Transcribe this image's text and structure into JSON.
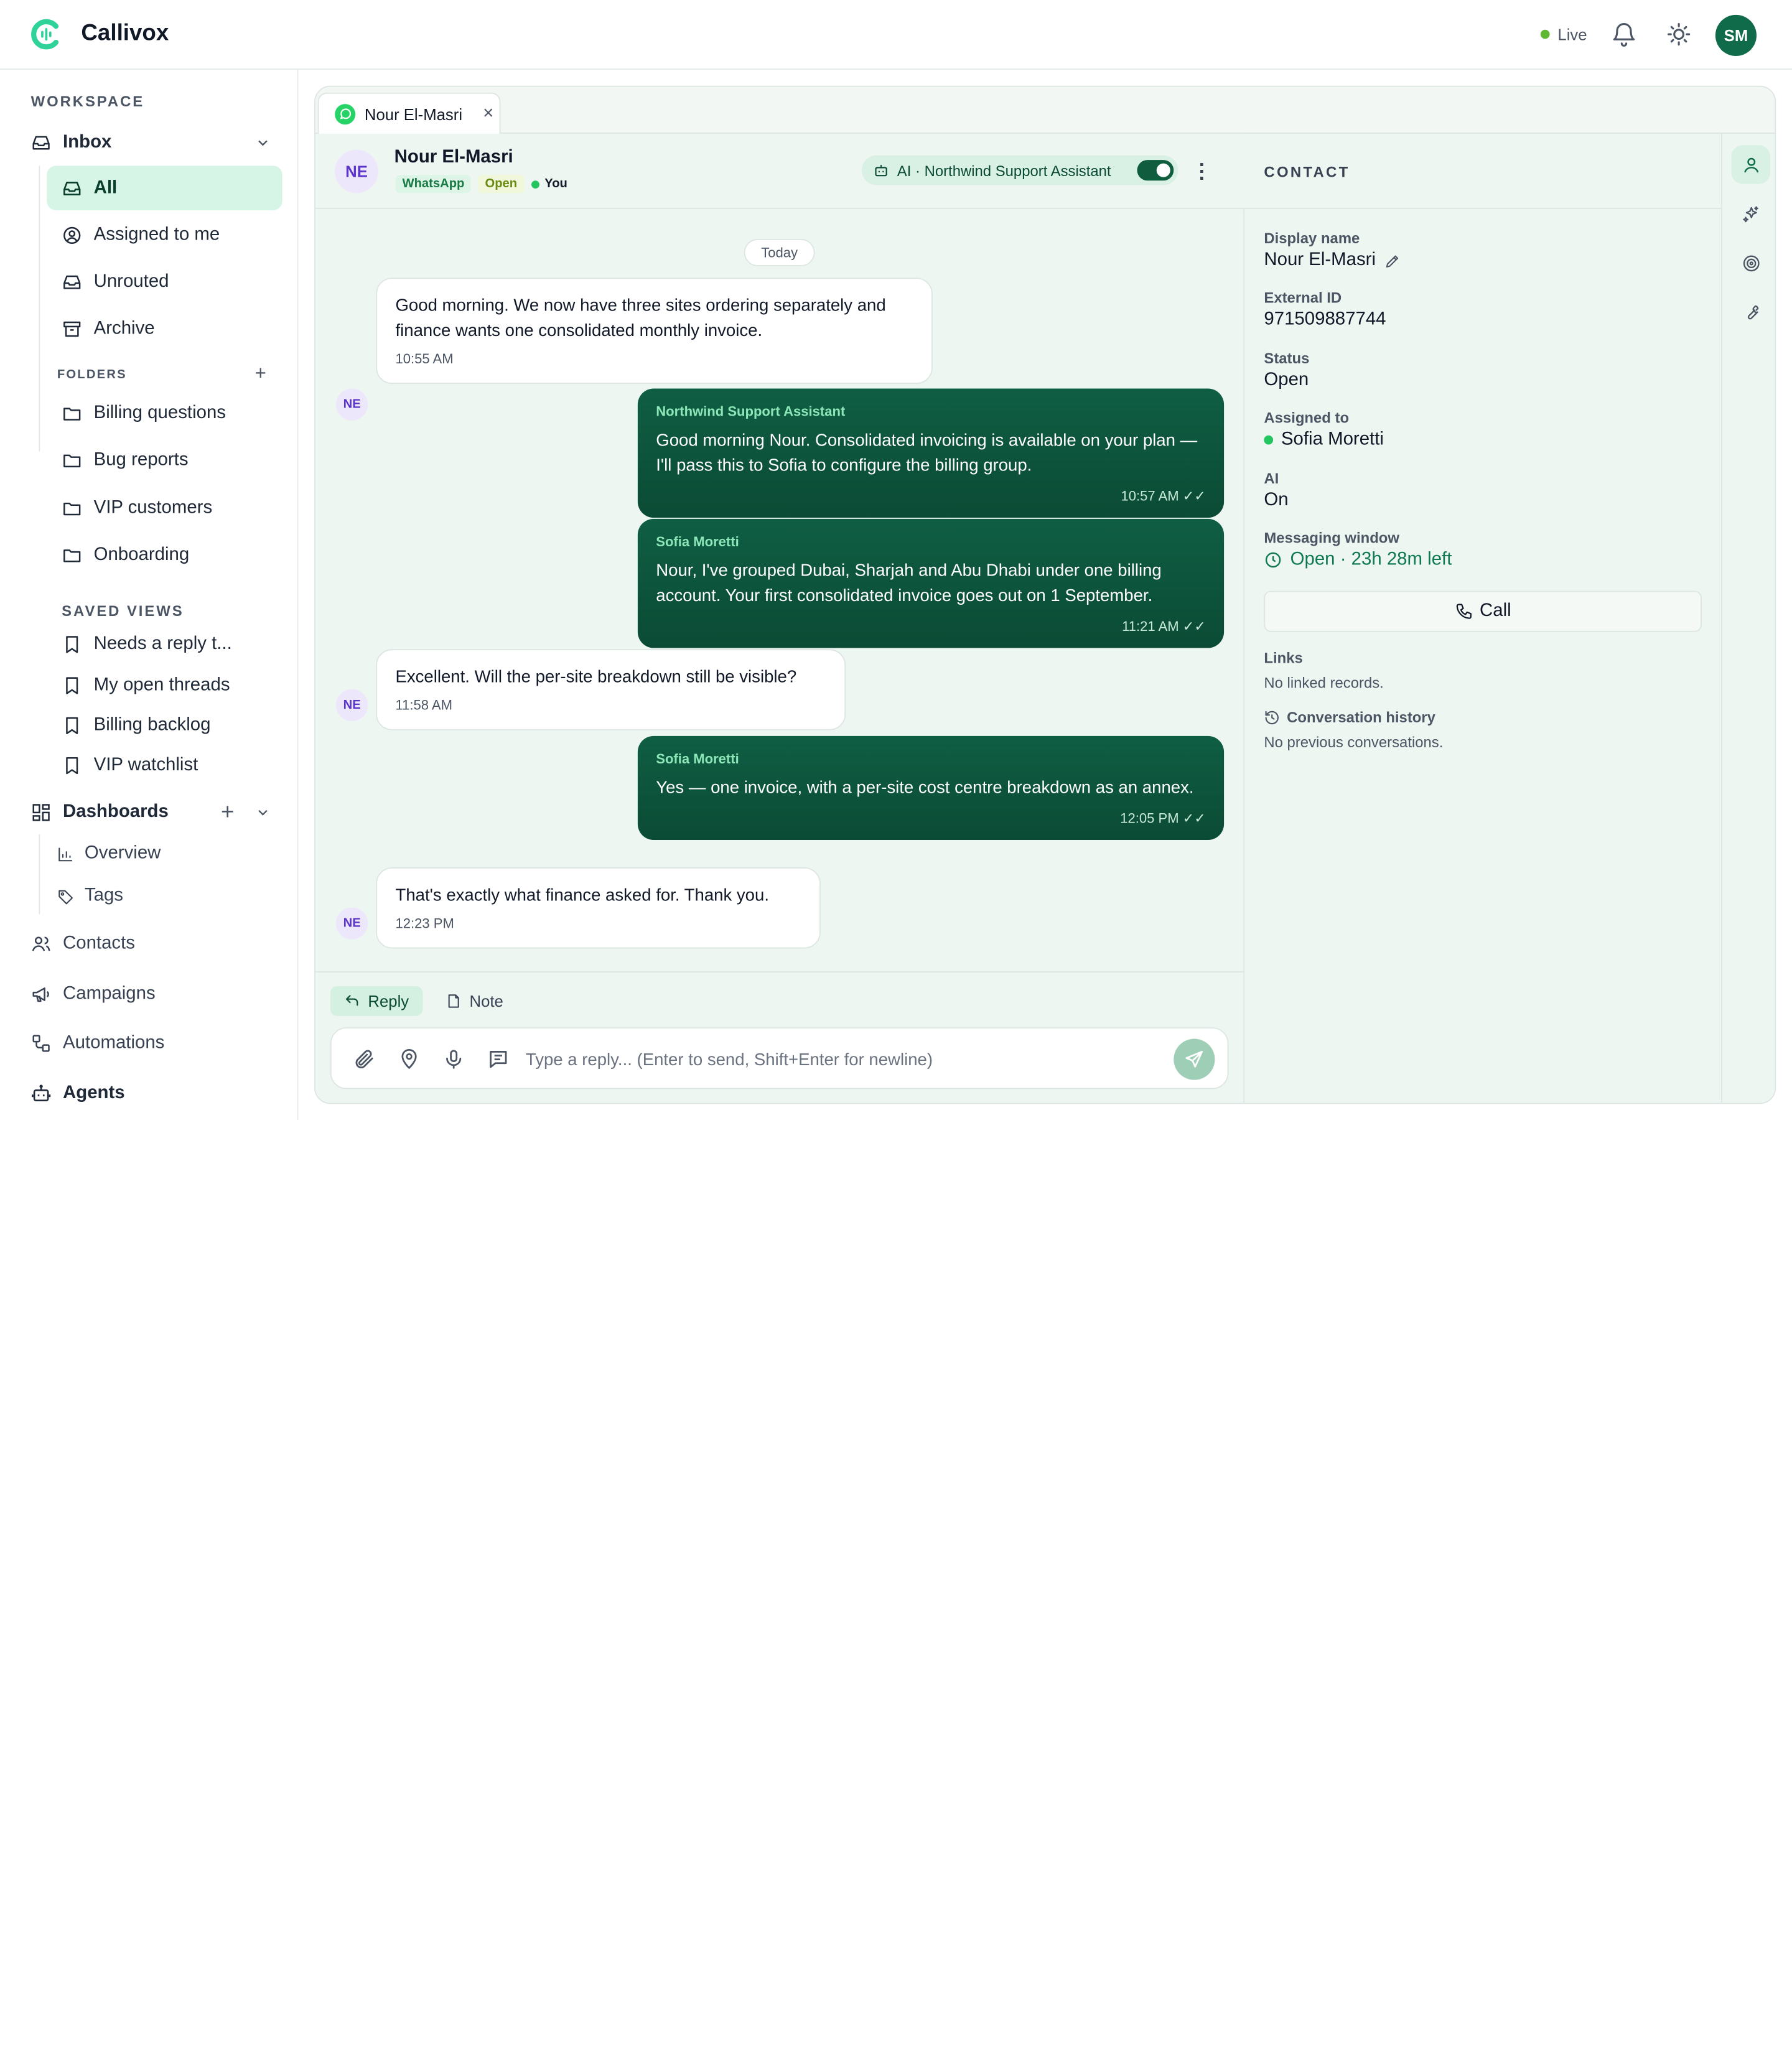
{
  "app": {
    "brand": "Callivox",
    "live_label": "Live",
    "user_initials": "SM"
  },
  "sidebar": {
    "workspace_label": "WORKSPACE",
    "inbox_label": "Inbox",
    "inbox_items": [
      {
        "label": "All",
        "icon": "inbox-icon",
        "active": true
      },
      {
        "label": "Assigned to me",
        "icon": "user-circle-icon"
      },
      {
        "label": "Unrouted",
        "icon": "inbox-icon"
      },
      {
        "label": "Archive",
        "icon": "archive-icon"
      }
    ],
    "folders_label": "FOLDERS",
    "folders": [
      "Billing questions",
      "Bug reports",
      "VIP customers",
      "Onboarding"
    ],
    "saved_views_label": "SAVED VIEWS",
    "saved_views": [
      "Needs a reply t...",
      "My open threads",
      "Billing backlog",
      "VIP watchlist"
    ],
    "dashboards_label": "Dashboards",
    "dashboard_items": [
      "Overview",
      "Tags"
    ],
    "bottom_items": [
      "Contacts",
      "Campaigns",
      "Automations",
      "Agents"
    ]
  },
  "tab": {
    "label": "Nour El-Masri",
    "close": "×"
  },
  "chat": {
    "contact_initials": "NE",
    "contact_name": "Nour El-Masri",
    "badge_channel": "WhatsApp",
    "badge_status": "Open",
    "badge_assignee": "You",
    "ai_label": "AI · Northwind Support Assistant",
    "ai_enabled": true,
    "day_label": "Today",
    "messages": [
      {
        "dir": "in",
        "text": "Good morning. We now have three sites ordering separately and finance wants one consolidated monthly invoice.",
        "time": "10:55 AM"
      },
      {
        "dir": "out",
        "sender": "Northwind Support Assistant",
        "text": "Good morning Nour. Consolidated invoicing is available on your plan — I'll pass this to Sofia to configure the billing group.",
        "time": "10:57 AM"
      },
      {
        "dir": "out",
        "sender": "Sofia Moretti",
        "text": "Nour, I've grouped Dubai, Sharjah and Abu Dhabi under one billing account. Your first consolidated invoice goes out on 1 September.",
        "time": "11:21 AM"
      },
      {
        "dir": "in",
        "text": "Excellent. Will the per-site breakdown still be visible?",
        "time": "11:58 AM"
      },
      {
        "dir": "out",
        "sender": "Sofia Moretti",
        "text": "Yes — one invoice, with a per-site cost centre breakdown as an annex.",
        "time": "12:05 PM"
      },
      {
        "dir": "in",
        "text": "That's exactly what finance asked for. Thank you.",
        "time": "12:23 PM"
      }
    ],
    "reply_tab": "Reply",
    "note_tab": "Note",
    "composer_placeholder": "Type a reply... (Enter to send, Shift+Enter for newline)"
  },
  "contact": {
    "title": "CONTACT",
    "display_name_label": "Display name",
    "display_name": "Nour El-Masri",
    "external_id_label": "External ID",
    "external_id": "971509887744",
    "status_label": "Status",
    "status": "Open",
    "assigned_label": "Assigned to",
    "assigned": "Sofia Moretti",
    "ai_label": "AI",
    "ai_value": "On",
    "window_label": "Messaging window",
    "window_value": "Open · 23h 28m left",
    "call_label": "Call",
    "links_label": "Links",
    "links_value": "No linked records.",
    "history_label": "Conversation history",
    "history_value": "No previous conversations."
  },
  "colors": {
    "accent": "#0f5e43",
    "accent_light": "#d6f5e6",
    "live": "#5fb831",
    "avatar_bg": "#0f6b4a"
  }
}
